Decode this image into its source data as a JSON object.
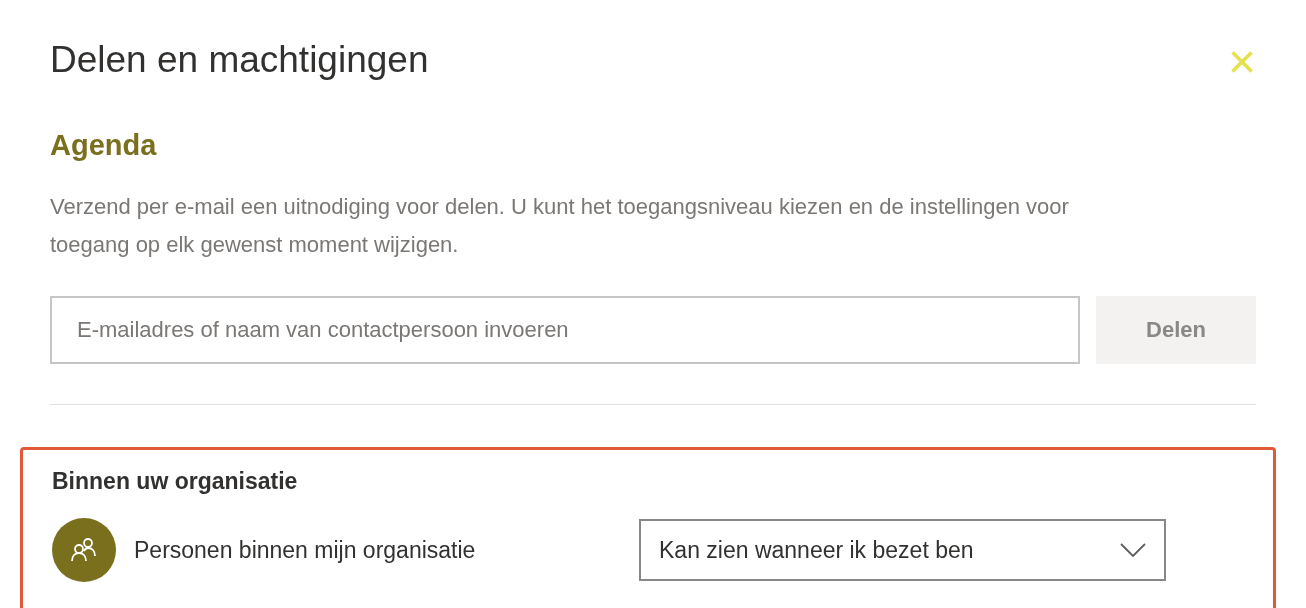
{
  "dialog": {
    "title": "Delen en machtigingen",
    "close": "×"
  },
  "section": {
    "heading": "Agenda",
    "description": "Verzend per e-mail een uitnodiging voor delen. U kunt het toegangsniveau kiezen en de instellingen voor toegang op elk gewenst moment wijzigen."
  },
  "share": {
    "placeholder": "E-mailadres of naam van contactpersoon invoeren",
    "button": {
      "label": "Delen",
      "disabled": true
    }
  },
  "organization": {
    "heading": "Binnen uw organisatie",
    "highlighted": true,
    "people": [
      {
        "name": "Personen binnen mijn organisatie",
        "permission": "Kan zien wanneer ik bezet ben"
      }
    ]
  }
}
